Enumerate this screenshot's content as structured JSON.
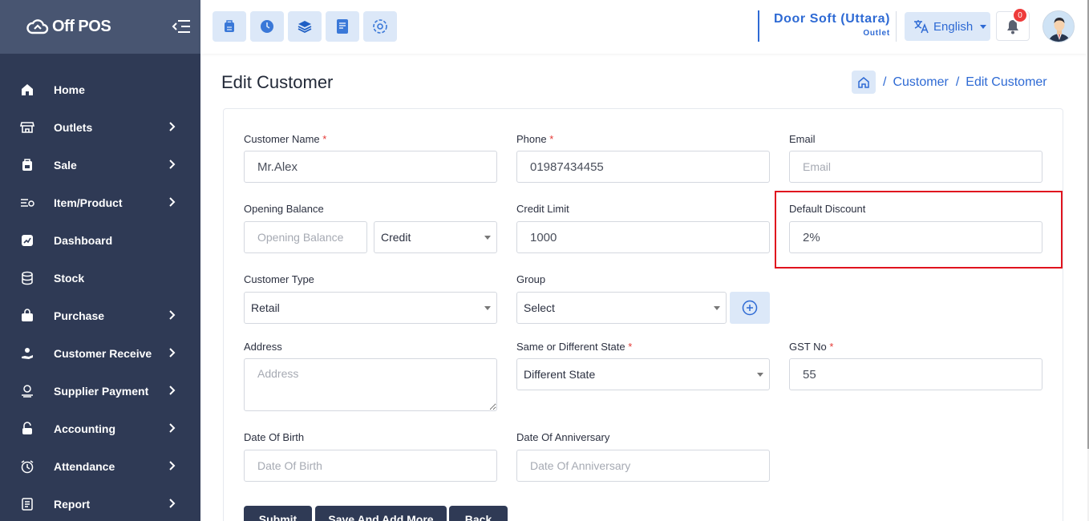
{
  "brand": {
    "name": "Off POS"
  },
  "sidebar": {
    "items": [
      {
        "label": "Home",
        "icon": "home-icon",
        "has_submenu": false
      },
      {
        "label": "Outlets",
        "icon": "store-icon",
        "has_submenu": true
      },
      {
        "label": "Sale",
        "icon": "cart-icon",
        "has_submenu": true
      },
      {
        "label": "Item/Product",
        "icon": "list-icon",
        "has_submenu": true
      },
      {
        "label": "Dashboard",
        "icon": "chart-icon",
        "has_submenu": false
      },
      {
        "label": "Stock",
        "icon": "database-icon",
        "has_submenu": false
      },
      {
        "label": "Purchase",
        "icon": "bag-icon",
        "has_submenu": true
      },
      {
        "label": "Customer Receive",
        "icon": "hand-money-icon",
        "has_submenu": true
      },
      {
        "label": "Supplier Payment",
        "icon": "money-icon",
        "has_submenu": true
      },
      {
        "label": "Accounting",
        "icon": "lock-icon",
        "has_submenu": true
      },
      {
        "label": "Attendance",
        "icon": "clock-icon",
        "has_submenu": true
      },
      {
        "label": "Report",
        "icon": "report-icon",
        "has_submenu": true
      }
    ]
  },
  "topbar": {
    "quick_buttons": [
      "pos-icon",
      "clock-icon",
      "layers-icon",
      "invoice-icon",
      "dashboard-icon"
    ],
    "outlet_name": "Door Soft (Uttara)",
    "outlet_sub": "Outlet",
    "language": "English",
    "notification_count": "0"
  },
  "page": {
    "title": "Edit Customer",
    "breadcrumb": {
      "link": "Customer",
      "current": "Edit Customer",
      "separator": "/"
    }
  },
  "form": {
    "customer_name": {
      "label": "Customer Name",
      "value": "Mr.Alex",
      "required": "*"
    },
    "phone": {
      "label": "Phone",
      "value": "01987434455",
      "required": "*"
    },
    "email": {
      "label": "Email",
      "placeholder": "Email"
    },
    "opening_balance": {
      "label": "Opening Balance",
      "placeholder": "Opening Balance",
      "type_value": "Credit"
    },
    "credit_limit": {
      "label": "Credit Limit",
      "value": "1000"
    },
    "default_discount": {
      "label": "Default Discount",
      "value": "2%"
    },
    "customer_type": {
      "label": "Customer Type",
      "value": "Retail"
    },
    "group": {
      "label": "Group",
      "value": "Select"
    },
    "address": {
      "label": "Address",
      "placeholder": "Address"
    },
    "state": {
      "label": "Same or Different State",
      "value": "Different State",
      "required": "*"
    },
    "gst_no": {
      "label": "GST No",
      "value": "55",
      "required": "*"
    },
    "dob": {
      "label": "Date Of Birth",
      "placeholder": "Date Of Birth"
    },
    "anniversary": {
      "label": "Date Of Anniversary",
      "placeholder": "Date Of Anniversary"
    }
  },
  "actions": {
    "submit": "Submit",
    "save_add_more": "Save And Add More",
    "back": "Back"
  },
  "colors": {
    "sidebar": "#2f3a55",
    "brand_bar": "#485571",
    "accent": "#2e6ad4",
    "highlight": "#e0131e"
  }
}
